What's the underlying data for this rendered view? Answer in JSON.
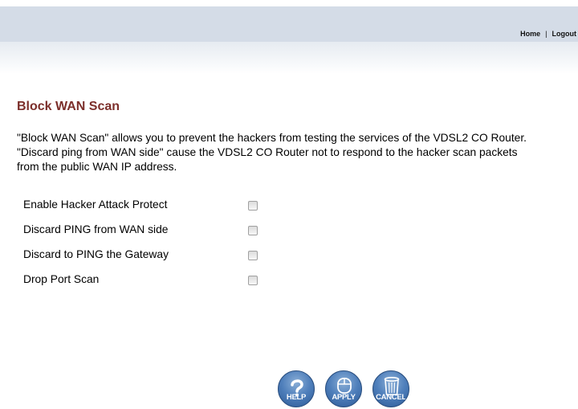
{
  "header": {
    "links": [
      {
        "label": "Home"
      },
      {
        "label": "Logout"
      }
    ],
    "separator": "|"
  },
  "page": {
    "title": "Block WAN Scan",
    "description": "\"Block WAN Scan\" allows you to prevent the hackers from testing the services of the VDSL2 CO Router. \"Discard ping from WAN side\" cause the VDSL2 CO Router not to respond to the hacker scan packets from the public WAN IP address."
  },
  "options": [
    {
      "label": "Enable Hacker Attack Protect",
      "checked": false
    },
    {
      "label": "Discard PING from WAN side",
      "checked": false
    },
    {
      "label": "Discard to PING the Gateway",
      "checked": false
    },
    {
      "label": "Drop Port Scan",
      "checked": false
    }
  ],
  "buttons": {
    "help": {
      "label": "HELP",
      "icon": "question-mark-icon"
    },
    "apply": {
      "label": "APPLY",
      "icon": "mouse-icon"
    },
    "cancel": {
      "label": "CANCEL",
      "icon": "trash-bin-icon"
    }
  },
  "colors": {
    "topbar": "#d4dce7",
    "title": "#7c2f2b",
    "button": "#4f7fbb"
  }
}
